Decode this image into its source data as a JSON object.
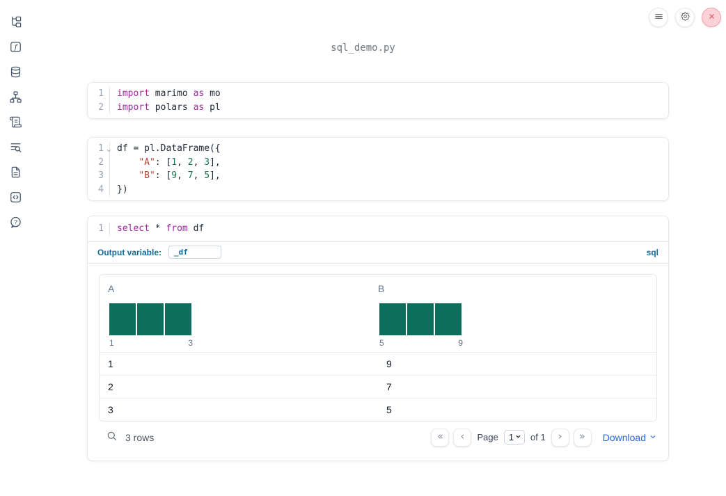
{
  "window": {
    "title": "sql_demo.py"
  },
  "topbar": {
    "buttons": [
      {
        "name": "notebook-menu",
        "icon": "menu-icon"
      },
      {
        "name": "settings",
        "icon": "gear-icon"
      },
      {
        "name": "shutdown",
        "icon": "x-icon"
      }
    ]
  },
  "sidebar": {
    "items": [
      {
        "name": "file-explorer",
        "icon": "tree-icon"
      },
      {
        "name": "variables",
        "icon": "function-icon"
      },
      {
        "name": "datasources",
        "icon": "database-icon"
      },
      {
        "name": "dependency-graph",
        "icon": "graph-icon"
      },
      {
        "name": "logs",
        "icon": "scroll-icon"
      },
      {
        "name": "snippets",
        "icon": "list-search-icon"
      },
      {
        "name": "documentation",
        "icon": "document-icon"
      },
      {
        "name": "scratchpad",
        "icon": "code-icon"
      },
      {
        "name": "help",
        "icon": "help-icon"
      }
    ]
  },
  "cells": [
    {
      "type": "python",
      "lines": [
        {
          "n": "1",
          "tokens": [
            {
              "t": "import",
              "c": "kw"
            },
            {
              "t": " marimo ",
              "c": "pl"
            },
            {
              "t": "as",
              "c": "kw"
            },
            {
              "t": " mo",
              "c": "pl"
            }
          ]
        },
        {
          "n": "2",
          "tokens": [
            {
              "t": "import",
              "c": "kw"
            },
            {
              "t": " polars ",
              "c": "pl"
            },
            {
              "t": "as",
              "c": "kw"
            },
            {
              "t": " pl",
              "c": "pl"
            }
          ]
        }
      ]
    },
    {
      "type": "python",
      "lines": [
        {
          "n": "1",
          "fold": true,
          "tokens": [
            {
              "t": "df = pl.DataFrame({",
              "c": "pl"
            }
          ]
        },
        {
          "n": "2",
          "tokens": [
            {
              "t": "    ",
              "c": "pl"
            },
            {
              "t": "\"A\"",
              "c": "str"
            },
            {
              "t": ": [",
              "c": "pl"
            },
            {
              "t": "1",
              "c": "num"
            },
            {
              "t": ", ",
              "c": "pl"
            },
            {
              "t": "2",
              "c": "num"
            },
            {
              "t": ", ",
              "c": "pl"
            },
            {
              "t": "3",
              "c": "num"
            },
            {
              "t": "],",
              "c": "pl"
            }
          ]
        },
        {
          "n": "3",
          "tokens": [
            {
              "t": "    ",
              "c": "pl"
            },
            {
              "t": "\"B\"",
              "c": "str"
            },
            {
              "t": ": [",
              "c": "pl"
            },
            {
              "t": "9",
              "c": "num"
            },
            {
              "t": ", ",
              "c": "pl"
            },
            {
              "t": "7",
              "c": "num"
            },
            {
              "t": ", ",
              "c": "pl"
            },
            {
              "t": "5",
              "c": "num"
            },
            {
              "t": "],",
              "c": "pl"
            }
          ]
        },
        {
          "n": "4",
          "tokens": [
            {
              "t": "})",
              "c": "pl"
            }
          ]
        }
      ]
    },
    {
      "type": "sql",
      "lines": [
        {
          "n": "1",
          "tokens": [
            {
              "t": "select",
              "c": "kw"
            },
            {
              "t": " * ",
              "c": "pl"
            },
            {
              "t": "from",
              "c": "kw"
            },
            {
              "t": " df",
              "c": "pl"
            }
          ]
        }
      ],
      "output_variable_label": "Output variable:",
      "output_variable_value": "_df",
      "language_badge": "sql"
    }
  ],
  "table": {
    "columns": [
      {
        "name": "A",
        "bars": [
          1,
          1,
          1
        ],
        "hist_min_label": "1",
        "hist_max_label": "3"
      },
      {
        "name": "B",
        "bars": [
          1,
          1,
          1
        ],
        "hist_min_label": "5",
        "hist_max_label": "9"
      }
    ],
    "rows": [
      [
        "1",
        "9"
      ],
      [
        "2",
        "7"
      ],
      [
        "3",
        "5"
      ]
    ],
    "row_count_label": "3 rows",
    "pagination": {
      "page_label": "Page",
      "page_value": "1",
      "of_label": "of 1"
    },
    "download_label": "Download"
  },
  "colors": {
    "keyword": "#a626a4",
    "string": "#b0443c",
    "number": "#14764b",
    "histogram_bar": "#0e6e5c",
    "sql_accent": "#146d96",
    "link": "#2563eb"
  }
}
